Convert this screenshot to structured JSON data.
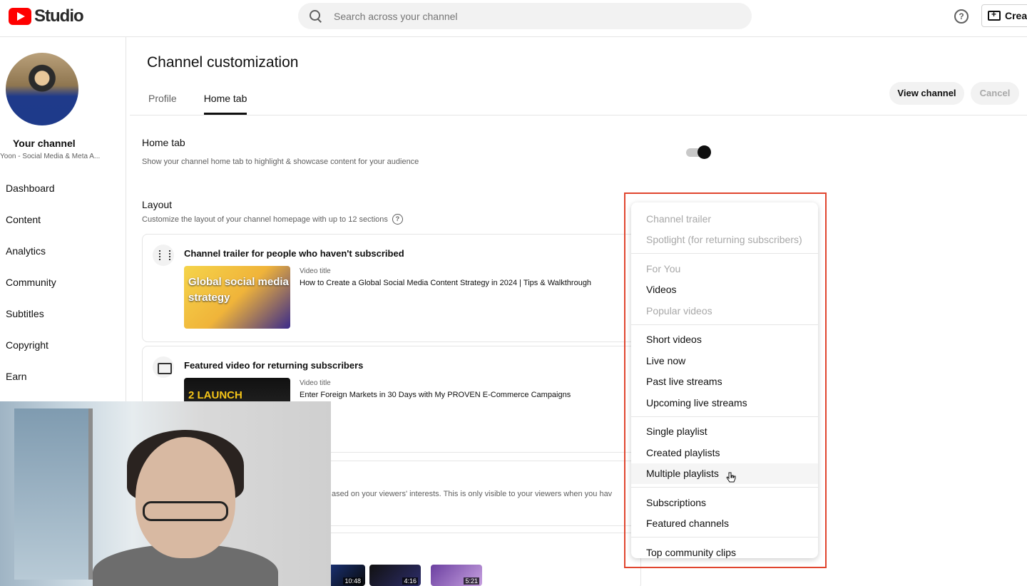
{
  "app": {
    "logo_text": "Studio",
    "brand_color": "#ff0000"
  },
  "header": {
    "search_placeholder": "Search across your channel",
    "help_icon": "?",
    "create_label": "Create"
  },
  "sidebar": {
    "channel_label": "Your channel",
    "channel_sub": "Yoon - Social Media & Meta A...",
    "items": [
      {
        "label": "Dashboard"
      },
      {
        "label": "Content"
      },
      {
        "label": "Analytics"
      },
      {
        "label": "Community"
      },
      {
        "label": "Subtitles"
      },
      {
        "label": "Copyright"
      },
      {
        "label": "Earn"
      }
    ]
  },
  "main": {
    "title": "Channel customization",
    "tabs": [
      {
        "label": "Profile",
        "active": false
      },
      {
        "label": "Home tab",
        "active": true
      }
    ],
    "view_channel": "View channel",
    "cancel": "Cancel",
    "home_tab": {
      "label": "Home tab",
      "description": "Show your channel home tab to highlight & showcase content for your audience",
      "enabled": true
    },
    "layout": {
      "label": "Layout",
      "description": "Customize the layout of your channel homepage with up to 12 sections",
      "help_icon": "?"
    },
    "cards": [
      {
        "title": "Channel trailer for people who haven't subscribed",
        "meta_label": "Video title",
        "video_title": "How to Create a Global Social Media Content Strategy in 2024 | Tips & Walkthrough",
        "thumb_text": "Global social media strategy"
      },
      {
        "title": "Featured video for returning subscribers",
        "meta_label": "Video title",
        "video_title": "Enter Foreign Markets in 30 Days with My PROVEN E-Commerce Campaigns",
        "thumb_text": "2 LAUNCH"
      },
      {
        "text": "ased on your viewers' interests. This is only visible to your viewers when you hav"
      }
    ],
    "mini_thumbs": [
      {
        "duration": "10:48"
      },
      {
        "duration": "4:16"
      },
      {
        "duration": "5:21"
      }
    ]
  },
  "menu": {
    "groups": [
      [
        {
          "label": "Channel trailer",
          "disabled": true
        },
        {
          "label": "Spotlight (for returning subscribers)",
          "disabled": true
        }
      ],
      [
        {
          "label": "For You",
          "disabled": true
        },
        {
          "label": "Videos",
          "disabled": false
        },
        {
          "label": "Popular videos",
          "disabled": true
        }
      ],
      [
        {
          "label": "Short videos",
          "disabled": false
        },
        {
          "label": "Live now",
          "disabled": false
        },
        {
          "label": "Past live streams",
          "disabled": false
        },
        {
          "label": "Upcoming live streams",
          "disabled": false
        }
      ],
      [
        {
          "label": "Single playlist",
          "disabled": false
        },
        {
          "label": "Created playlists",
          "disabled": false
        },
        {
          "label": "Multiple playlists",
          "disabled": false,
          "hover": true
        }
      ],
      [
        {
          "label": "Subscriptions",
          "disabled": false
        },
        {
          "label": "Featured channels",
          "disabled": false
        }
      ],
      [
        {
          "label": "Top community clips",
          "disabled": false
        }
      ]
    ],
    "highlight_color": "#e0452e"
  }
}
